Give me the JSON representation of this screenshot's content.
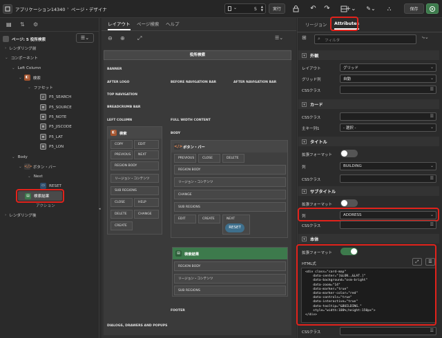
{
  "toolbar": {
    "app_crumb": "アプリケーション14340",
    "page_crumb": "ページ・デザイナ",
    "page_number": "5",
    "run_button": "実行",
    "save_button": "保存"
  },
  "left_panel": {
    "page_title": "ページ: 5 役所検索",
    "tree": {
      "rendering_before": "レンダリング前",
      "components": "コンポーネント",
      "left_column": "Left Column",
      "search_region": "検索",
      "facets": "ファセット",
      "items": [
        "P5_SEARCH",
        "P5_SOURCE",
        "P5_NOTE",
        "P5_JISCODE",
        "P5_LAT",
        "P5_LON"
      ],
      "body": "Body",
      "button_bar": "ボタン・バー",
      "next": "Next",
      "reset": "RESET",
      "search_results": "検索結果",
      "actions": "アクション",
      "rendering_after": "レンダリング後"
    }
  },
  "center": {
    "tabs": [
      "レイアウト",
      "ページ検索",
      "ヘルプ"
    ],
    "page_banner": "役所検索",
    "positions": {
      "banner": "BANNER",
      "after_logo": "AFTER LOGO",
      "before_navigation_bar": "BEFORE NAVIGATION BAR",
      "after_navigation_bar": "AFTER NAVIGATION BAR",
      "top_navigation": "TOP NAVIGATION",
      "breadcrumb_bar": "BREADCRUMB BAR",
      "left_column": "LEFT COLUMN",
      "full_width_content": "FULL WIDTH CONTENT",
      "body": "BODY",
      "footer": "FOOTER",
      "dialogs": "DIALOGS, DRAWERS AND POPUPS"
    },
    "search_region": {
      "title": "検索",
      "copy": "COPY",
      "edit": "EDIT",
      "previous": "PREVIOUS",
      "next": "NEXT",
      "region_body": "REGION BODY",
      "region_content": "リージョン・コンテンツ",
      "sub_regions": "SUB REGIONS",
      "close": "CLOSE",
      "help": "HELP",
      "delete": "DELETE",
      "change": "CHANGE",
      "create": "CREATE"
    },
    "button_bar_region": {
      "title": "ボタン・バー",
      "previous": "PREVIOUS",
      "close": "CLOSE",
      "delete": "DELETE",
      "region_body": "REGION BODY",
      "region_content": "リージョン・コンテンツ",
      "change": "CHANGE",
      "sub_regions": "SUB REGIONS",
      "edit": "EDIT",
      "create": "CREATE",
      "next": "NEXT",
      "reset": "RESET"
    },
    "results_region": {
      "title": "検索結果",
      "region_body": "REGION BODY",
      "region_content": "リージョン・コンテンツ",
      "sub_regions": "SUB REGIONS"
    }
  },
  "right_panel": {
    "tabs": [
      "リージョン",
      "Attributes"
    ],
    "filter_placeholder": "フィルタ",
    "sections": {
      "appearance": {
        "header": "外観",
        "layout_label": "レイアウト",
        "layout_value": "グリッド",
        "grid_columns_label": "グリッド列",
        "grid_columns_value": "自動",
        "css_label": "CSSクラス"
      },
      "card": {
        "header": "カード",
        "css_label": "CSSクラス",
        "primary_key_label": "主キー列1",
        "primary_key_value": "- 選択 -"
      },
      "title": {
        "header": "タイトル",
        "advanced_label": "拡張フォーマット",
        "column_label": "列",
        "column_value": "BUILDING",
        "css_label": "CSSクラス"
      },
      "subtitle": {
        "header": "サブタイトル",
        "advanced_label": "拡張フォーマット",
        "column_label": "列",
        "column_value": "ADDRESS",
        "css_label": "CSSクラス"
      },
      "body": {
        "header": "本体",
        "advanced_label": "拡張フォーマット",
        "html_label": "HTML式",
        "code": "<div class=\"card-map\"\n    data-center=\"[&LON.,&LAT.]\"\n    data-background=\"osm-bright\"\n    data-zoom=\"14\"\n    data-marker=\"true\"\n    data-marker-color=\"red\"\n    data-controls=\"true\"\n    data-interactive=\"true\"\n    data-tooltip=\"&BUILDING.\"\n    style=\"width:100%;height:150px\">\n</div>",
        "css_label": "CSSクラス"
      }
    },
    "toggles": {
      "title_advanced": false,
      "subtitle_advanced": false,
      "body_advanced": true
    }
  },
  "colors": {
    "highlight": "#e3221b",
    "accent_green": "#3d7a4c",
    "region_orange": "#a5542e"
  }
}
